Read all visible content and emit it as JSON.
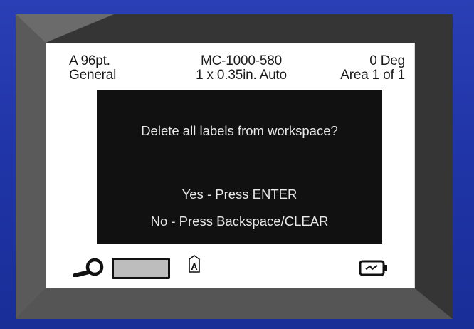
{
  "status": {
    "font_size": "A 96pt.",
    "font_style": "General",
    "cartridge": "MC-1000-580",
    "label_size": "1 x 0.35in.  Auto",
    "rotation": "0 Deg",
    "area": "Area  1 of 1"
  },
  "dialog": {
    "question": "Delete all labels from workspace?",
    "yes_option": "Yes - Press ENTER",
    "no_option": "No - Press Backspace/CLEAR"
  },
  "icons": {
    "zoom": "magnifier-icon",
    "label_preview": "label-preview-icon",
    "font": "font-icon",
    "power": "battery-charging-icon"
  }
}
